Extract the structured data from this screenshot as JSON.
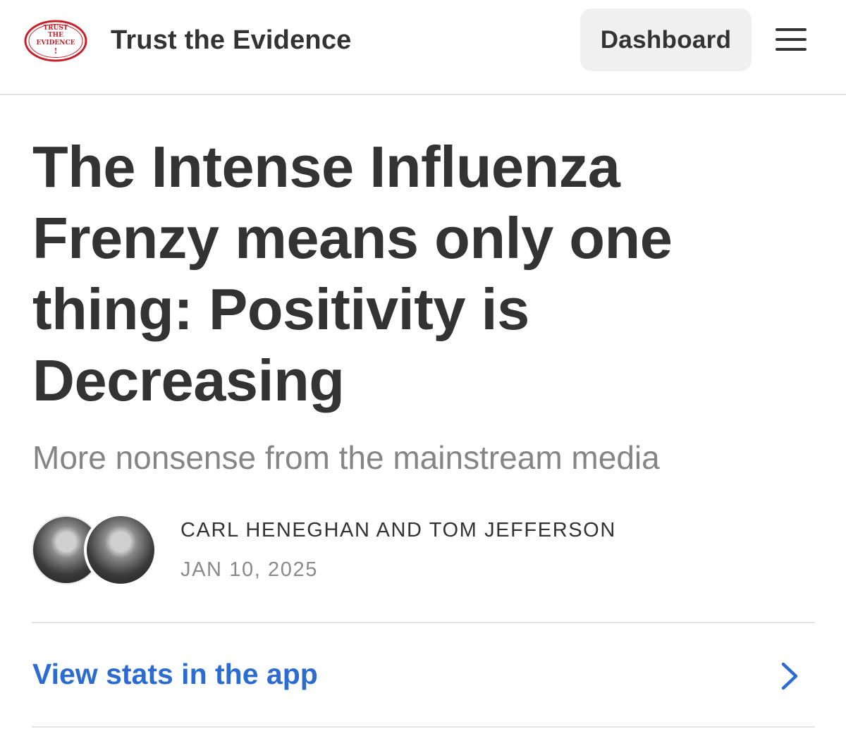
{
  "header": {
    "logo_text": [
      "TRUST",
      "THE",
      "EVIDENCE",
      "!"
    ],
    "publication_name": "Trust the Evidence",
    "dashboard_label": "Dashboard",
    "menu_icon": "hamburger-menu-icon"
  },
  "article": {
    "title": "The Intense Influenza Frenzy means only one thing: Positivity is Decreasing",
    "subtitle": "More nonsense from the mainstream media",
    "authors": "CARL HENEGHAN AND TOM JEFFERSON",
    "date": "JAN 10, 2025"
  },
  "stats": {
    "link_label": "View stats in the app",
    "chevron_icon": "chevron-right-icon"
  },
  "colors": {
    "link": "#2c6bcf",
    "logo_red": "#c8202a",
    "text": "#333333",
    "muted": "#858585"
  }
}
